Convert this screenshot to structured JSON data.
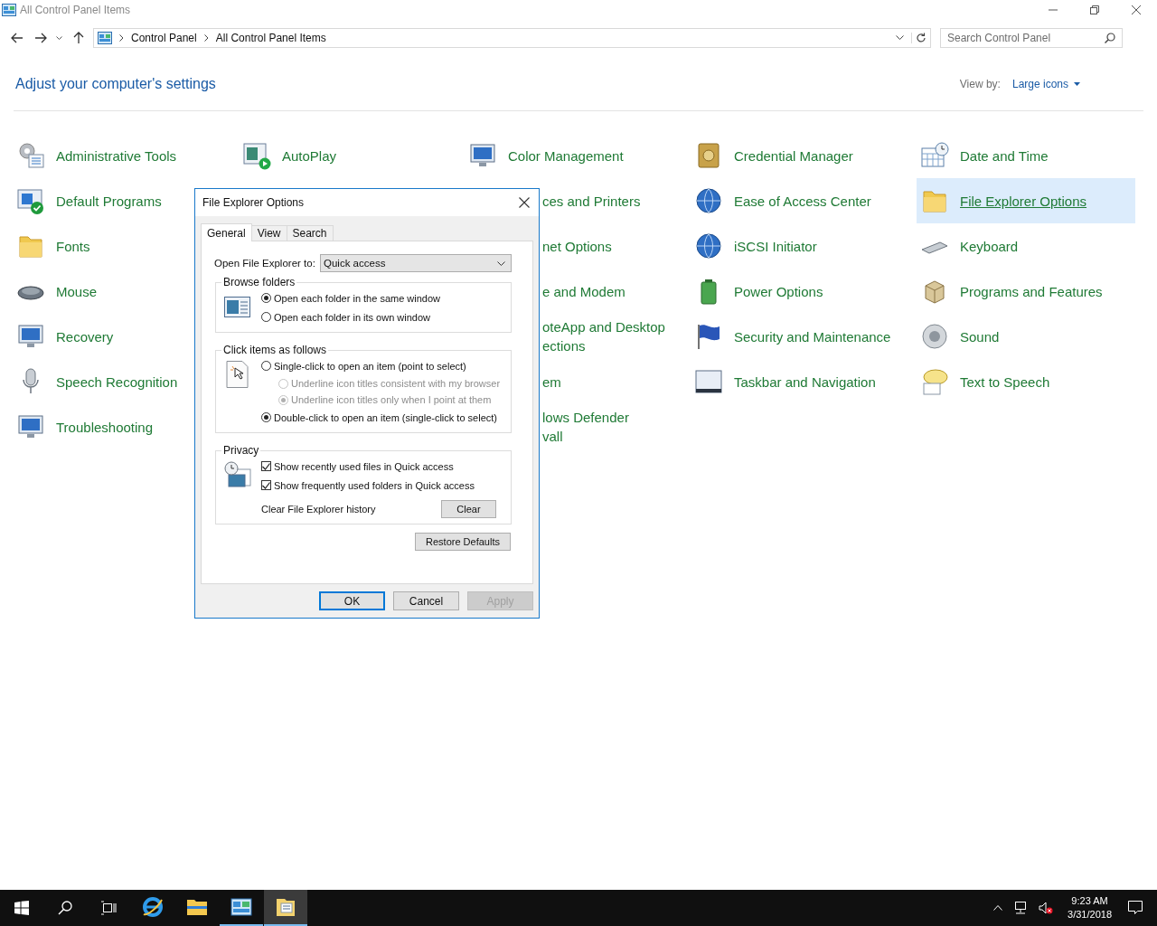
{
  "window": {
    "title": "All Control Panel Items"
  },
  "address_bar": {
    "breadcrumbs": [
      "Control Panel",
      "All Control Panel Items"
    ]
  },
  "search": {
    "placeholder": "Search Control Panel"
  },
  "heading": "Adjust your computer's settings",
  "view_by": {
    "label": "View by:",
    "value": "Large icons"
  },
  "columns": [
    [
      {
        "kind": "full",
        "label": "Administrative Tools",
        "selected": false
      },
      {
        "kind": "full",
        "label": "Default Programs",
        "selected": false
      },
      {
        "kind": "full",
        "label": "Fonts",
        "selected": false
      },
      {
        "kind": "full",
        "label": "Mouse",
        "selected": false
      },
      {
        "kind": "full",
        "label": "Recovery",
        "selected": false
      },
      {
        "kind": "full",
        "label": "Speech Recognition",
        "selected": false
      },
      {
        "kind": "full",
        "label": "Troubleshooting",
        "selected": false
      }
    ],
    [
      {
        "kind": "full",
        "label": "AutoPlay",
        "selected": false
      }
    ],
    [
      {
        "kind": "full",
        "label": "Color Management",
        "selected": false
      },
      {
        "kind": "clipped",
        "label": "ces and Printers",
        "selected": false
      },
      {
        "kind": "clipped",
        "label": "net Options",
        "selected": false
      },
      {
        "kind": "clipped",
        "label": "e and Modem",
        "selected": false
      },
      {
        "kind": "clipped",
        "lines": [
          "oteApp and Desktop",
          "ections"
        ],
        "selected": false
      },
      {
        "kind": "clipped",
        "label": "em",
        "selected": false
      },
      {
        "kind": "clipped",
        "lines": [
          "lows Defender",
          "vall"
        ],
        "selected": false
      }
    ],
    [
      {
        "kind": "full",
        "label": "Credential Manager",
        "selected": false
      },
      {
        "kind": "full",
        "label": "Ease of Access Center",
        "selected": false
      },
      {
        "kind": "full",
        "label": "iSCSI Initiator",
        "selected": false
      },
      {
        "kind": "full",
        "label": "Power Options",
        "selected": false
      },
      {
        "kind": "full",
        "label": "Security and Maintenance",
        "selected": false
      },
      {
        "kind": "full",
        "label": "Taskbar and Navigation",
        "selected": false
      }
    ],
    [
      {
        "kind": "full",
        "label": "Date and Time",
        "selected": false
      },
      {
        "kind": "full",
        "label": "File Explorer Options",
        "selected": true
      },
      {
        "kind": "full",
        "label": "Keyboard",
        "selected": false
      },
      {
        "kind": "full",
        "label": "Programs and Features",
        "selected": false
      },
      {
        "kind": "full",
        "label": "Sound",
        "selected": false
      },
      {
        "kind": "full",
        "label": "Text to Speech",
        "selected": false
      }
    ]
  ],
  "dialog": {
    "title": "File Explorer Options",
    "tabs": [
      {
        "label": "General",
        "selected": true
      },
      {
        "label": "View",
        "selected": false
      },
      {
        "label": "Search",
        "selected": false
      }
    ],
    "open_to": {
      "label": "Open File Explorer to:",
      "value": "Quick access"
    },
    "groups": [
      {
        "title": "Browse folders",
        "options": [
          {
            "kind": "radio",
            "label": "Open each folder in the same window",
            "selected": true,
            "disabled": false
          },
          {
            "kind": "radio",
            "label": "Open each folder in its own window",
            "selected": false,
            "disabled": false
          }
        ]
      },
      {
        "title": "Click items as follows",
        "options": [
          {
            "kind": "radio",
            "label": "Single-click to open an item (point to select)",
            "selected": false,
            "disabled": false,
            "children": [
              {
                "kind": "radio",
                "label": "Underline icon titles consistent with my browser",
                "selected": false,
                "disabled": true
              },
              {
                "kind": "radio",
                "label": "Underline icon titles only when I point at them",
                "selected": true,
                "disabled": true
              }
            ]
          },
          {
            "kind": "radio",
            "label": "Double-click to open an item (single-click to select)",
            "selected": true,
            "disabled": false
          }
        ]
      },
      {
        "title": "Privacy",
        "options": [
          {
            "kind": "checkbox",
            "label": "Show recently used files in Quick access",
            "checked": true,
            "disabled": false
          },
          {
            "kind": "checkbox",
            "label": "Show frequently used folders in Quick access",
            "checked": true,
            "disabled": false
          }
        ],
        "clear": {
          "label": "Clear File Explorer history",
          "button": "Clear"
        }
      }
    ],
    "restore_button": "Restore Defaults",
    "buttons": [
      {
        "label": "OK",
        "default": true,
        "disabled": false
      },
      {
        "label": "Cancel",
        "default": false,
        "disabled": false
      },
      {
        "label": "Apply",
        "default": false,
        "disabled": true
      }
    ]
  },
  "taskbar": {
    "apps": [
      {
        "running": false,
        "selected": false
      },
      {
        "running": false,
        "selected": false
      },
      {
        "running": true,
        "selected": false
      },
      {
        "running": true,
        "selected": true
      }
    ]
  },
  "clock": {
    "time": "9:23 AM",
    "date": "3/31/2018"
  }
}
